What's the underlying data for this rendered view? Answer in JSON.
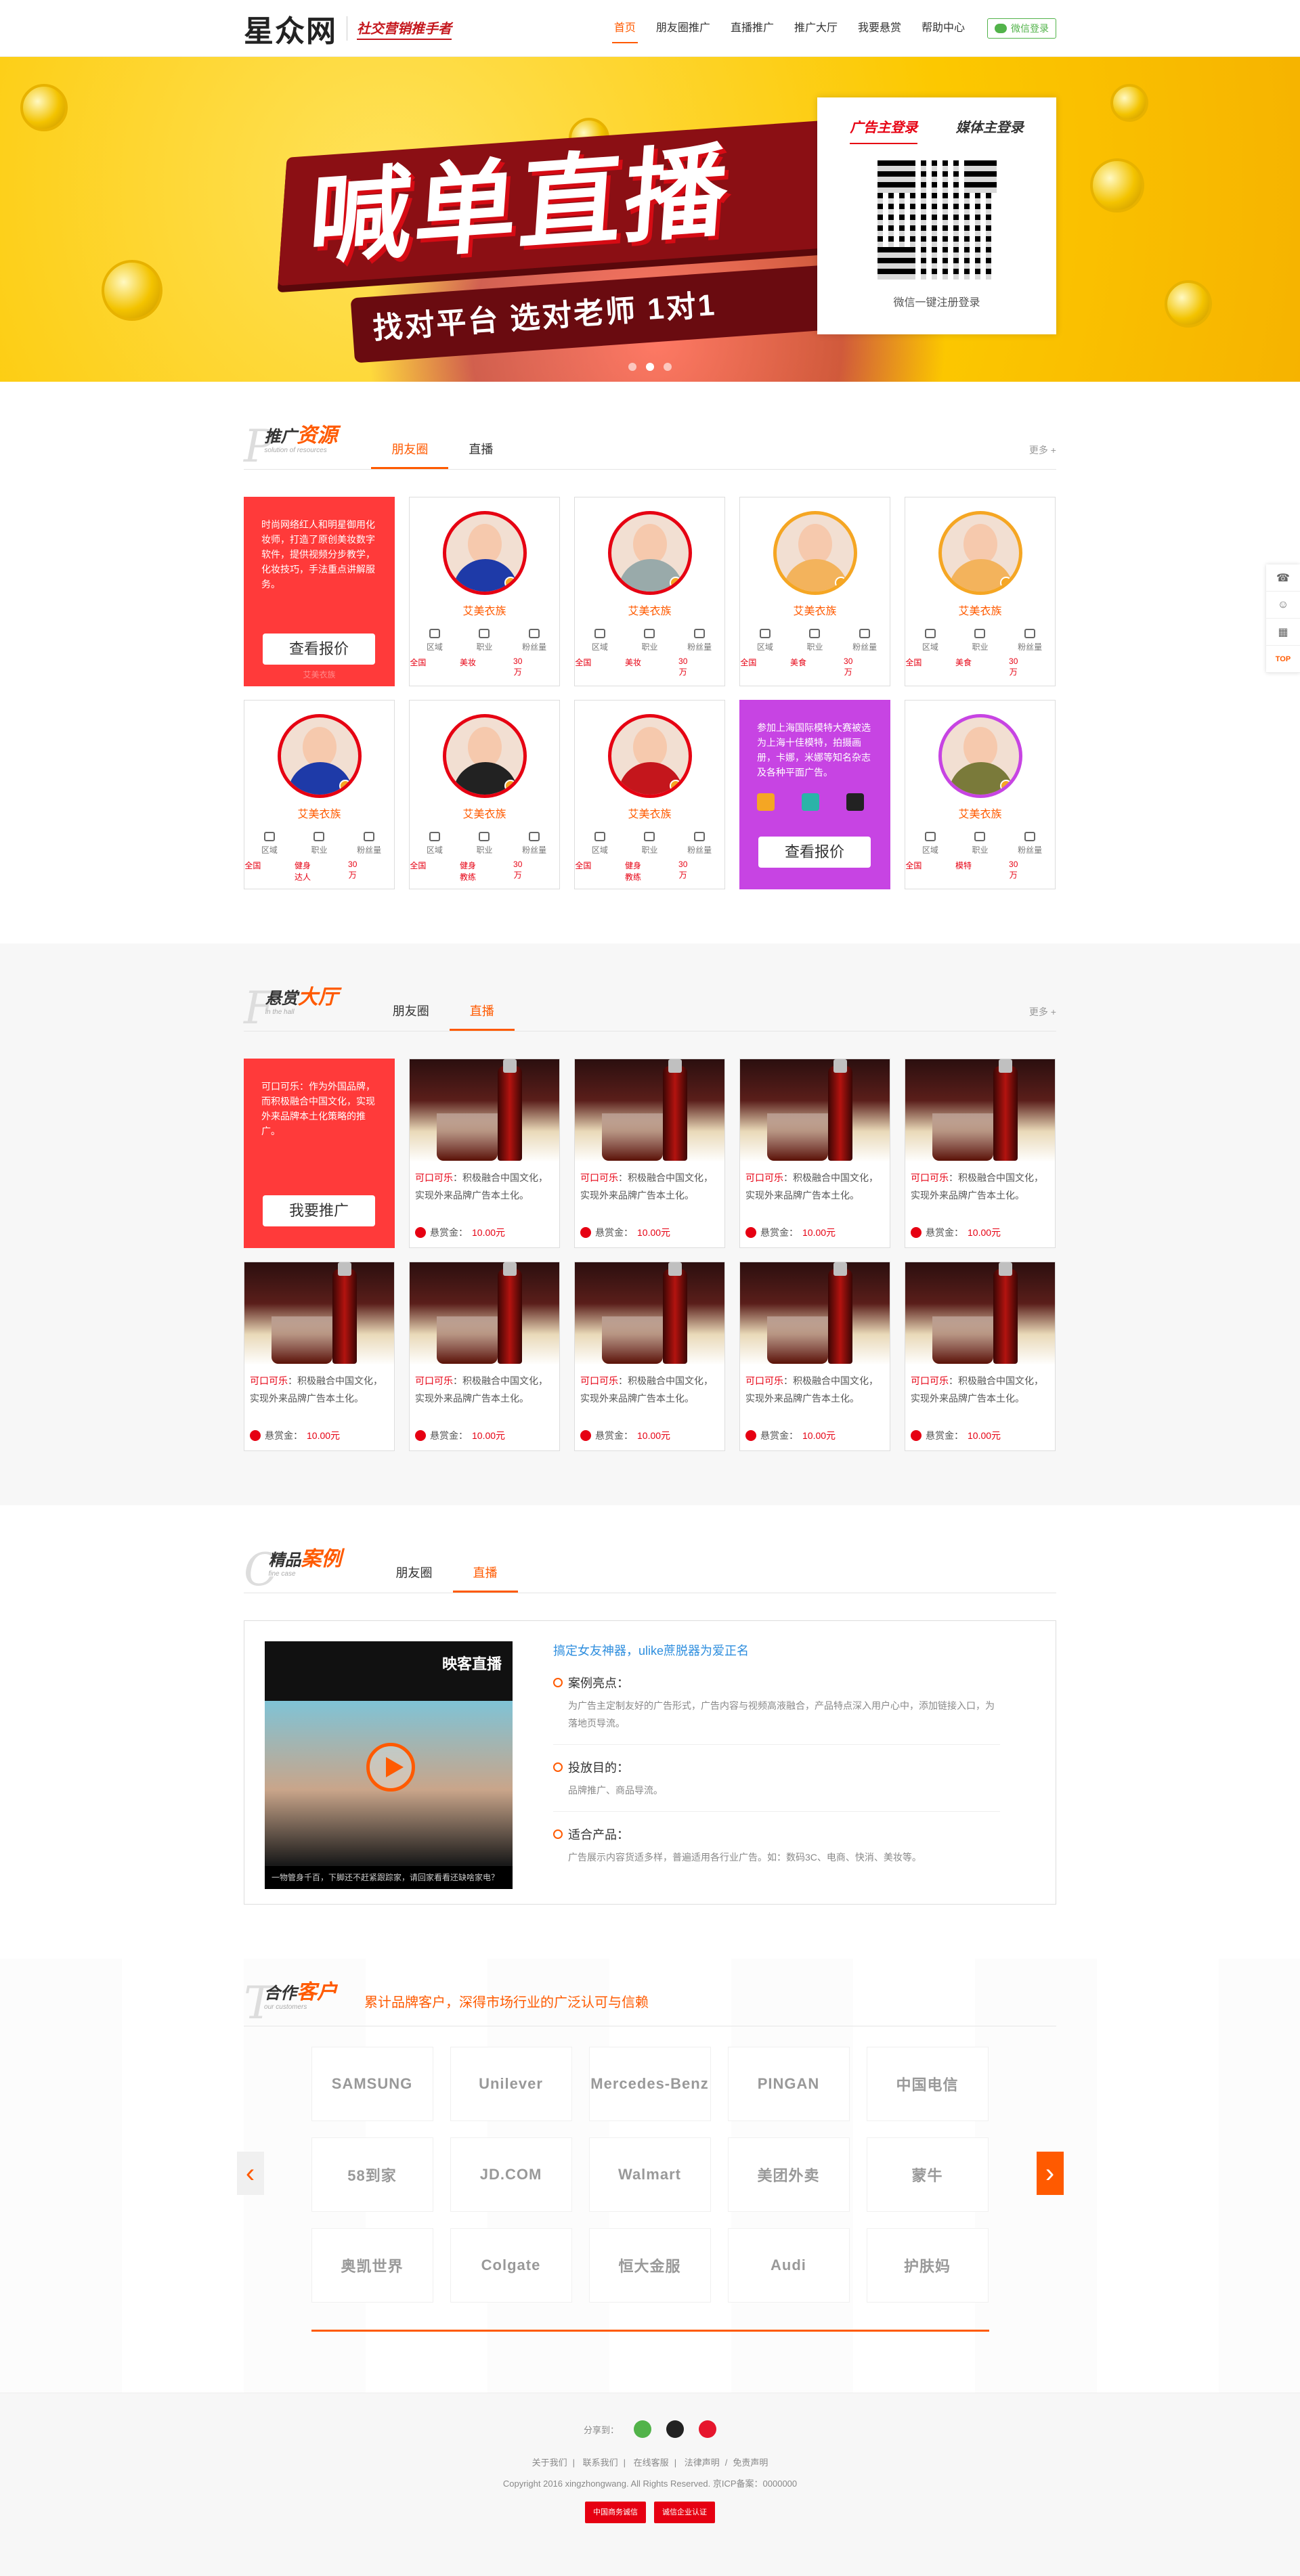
{
  "header": {
    "logo": "星众网",
    "slogan": "社交营销推手者",
    "nav": [
      {
        "label": "首页",
        "active": true
      },
      {
        "label": "朋友圈推广"
      },
      {
        "label": "直播推广"
      },
      {
        "label": "推广大厅"
      },
      {
        "label": "我要悬赏"
      },
      {
        "label": "帮助中心"
      }
    ],
    "wechat_login": "微信登录"
  },
  "banner": {
    "title": "喊单直播",
    "subtitle": "找对平台 选对老师 1对1",
    "login_tabs": [
      "广告主登录",
      "媒体主登录"
    ],
    "qr_caption": "微信一键注册登录",
    "dots": 3,
    "active_dot": 1
  },
  "promo": {
    "letter": "P",
    "title_a": "推广",
    "title_b": "资源",
    "en": "solution of resources",
    "tabs": [
      "朋友圈",
      "直播"
    ],
    "active_tab": 0,
    "more": "更多 +",
    "hot1": {
      "text": "时尚网络红人和明星御用化妆师，打造了原创美妆数字软件，提供视频分步教学，化妆技巧，手法重点讲解服务。",
      "button": "查看报价",
      "ghost_name": "艾美衣族"
    },
    "hot2": {
      "text": "参加上海国际模特大赛被选为上海十佳模特，拍摄画册，卡娜，米娜等知名杂志及各种平面广告。",
      "button": "查看报价"
    },
    "meta_labels": [
      "区域",
      "职业",
      "粉丝量"
    ],
    "cards": [
      {
        "name": "艾美衣族",
        "region": "全国",
        "job": "美妆",
        "fans": "30万",
        "color": "#1e3aa8"
      },
      {
        "name": "艾美衣族",
        "region": "全国",
        "job": "美妆",
        "fans": "30万",
        "color": "#9aa"
      },
      {
        "name": "艾美衣族",
        "region": "全国",
        "job": "美食",
        "fans": "30万",
        "color": "#f3b35c"
      },
      {
        "name": "艾美衣族",
        "region": "全国",
        "job": "美食",
        "fans": "30万",
        "color": "#f3b35c"
      },
      {
        "name": "艾美衣族",
        "region": "全国",
        "job": "健身达人",
        "fans": "30万",
        "color": "#1e3aa8"
      },
      {
        "name": "艾美衣族",
        "region": "全国",
        "job": "健身教练",
        "fans": "30万",
        "color": "#222"
      },
      {
        "name": "艾美衣族",
        "region": "全国",
        "job": "健身教练",
        "fans": "30万",
        "color": "#c4161c"
      },
      {
        "name": "艾美衣族",
        "region": "全国",
        "job": "模特",
        "fans": "30万",
        "color": "#7a7a3a"
      }
    ]
  },
  "reward": {
    "letter": "F",
    "title_a": "悬赏",
    "title_b": "大厅",
    "en": "in the hall",
    "tabs": [
      "朋友圈",
      "直播"
    ],
    "active_tab": 1,
    "more": "更多 +",
    "hot_text": "可口可乐：作为外国品牌，而积极融合中国文化，实现外来品牌本土化策略的推广。",
    "hot_button": "我要推广",
    "card_key": "可口可乐",
    "card_text": "：积极融合中国文化，实现外来品牌广告本土化。",
    "bounty_label": "悬赏金：",
    "bounty_value": "10.00元",
    "card_count": 9
  },
  "cases": {
    "letter": "C",
    "title_a": "精品",
    "title_b": "案例",
    "en": "fine case",
    "tabs": [
      "朋友圈",
      "直播"
    ],
    "active_tab": 1,
    "video_logo": "映客直播",
    "video_caption": "一物管身千百，下脚还不赶紧跟踪家，请回家看看还缺啥家电？",
    "title": "搞定女友神器，ulike蔗脱器为爱正名",
    "items": [
      {
        "h": "案例亮点：",
        "p": "为广告主定制友好的广告形式，广告内容与视频高液融合，产品特点深入用户心中，添加链接入口，为落地页导流。"
      },
      {
        "h": "投放目的：",
        "p": "品牌推广、商品导流。"
      },
      {
        "h": "适合产品：",
        "p": "广告展示内容货适多样，普遍适用各行业广告。如：数码3C、电商、快消、美妆等。"
      }
    ]
  },
  "partners": {
    "letter": "T",
    "title_a": "合作",
    "title_b": "客户",
    "en": "our customers",
    "tagline": "累计品牌客户，深得市场行业的广泛认可与信赖",
    "logos": [
      "SAMSUNG",
      "Unilever",
      "Mercedes-Benz",
      "PINGAN",
      "中国电信",
      "58到家",
      "JD.COM",
      "Walmart",
      "美团外卖",
      "蒙牛",
      "奥凯世界",
      "Colgate",
      "恒大金服",
      "Audi",
      "护肤妈"
    ]
  },
  "footer": {
    "share_label": "分享到：",
    "links": [
      "关于我们",
      "联系我们",
      "在线客服",
      "法律声明",
      "免责声明"
    ],
    "copyright": "Copyright 2016 xingzhongwang. All Rights Reserved. 京ICP备案：0000000",
    "badges": [
      "中国商务诚信",
      "诚信企业认证"
    ]
  },
  "side": [
    "电话",
    "客服",
    "二维码",
    "TOP"
  ]
}
